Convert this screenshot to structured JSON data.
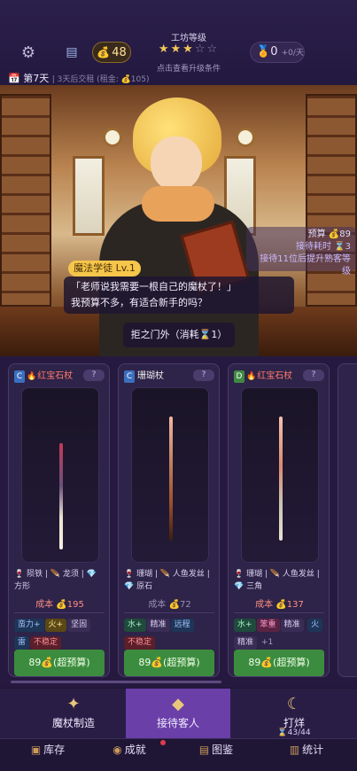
{
  "header": {
    "gold": "48",
    "rank_title": "工坊等级",
    "stars_filled": "★★★",
    "stars_empty": "☆☆",
    "rank_hint": "点击查看升级条件",
    "medal_value": "0",
    "medal_rate": "+0/天",
    "day": "第7天",
    "day_sub": "| 3天后交租 (租金: 💰105)"
  },
  "scene": {
    "budget_line1": "预算 💰89",
    "budget_line2": "接待耗时 ⌛3",
    "budget_line3": "接待11位后提升熟客等级",
    "customer_name": "魔法学徒 Lv.1",
    "dialog_line1": "「老师说我需要一根自己的魔杖了！」",
    "dialog_line2": "我预算不多，有适合新手的吗？",
    "reject_button": "拒之门外（消耗⌛1）"
  },
  "cards": [
    {
      "grade": "C",
      "fire": "🔥",
      "name": "红宝石杖",
      "q": "?",
      "mats": "🍷 陨铁 | 🪶 龙须 | 💎 方形",
      "cost_label": "成本",
      "cost": "💰195",
      "tags": [
        "蛮力+",
        "火+",
        "坚固",
        "雷",
        "不稳定"
      ],
      "buy": "89💰(超预算)"
    },
    {
      "grade": "C",
      "fire": "",
      "name": "珊瑚杖",
      "q": "?",
      "mats": "🍷 珊瑚 | 🪶 人鱼发丝 | 💎 原石",
      "cost_label": "成本",
      "cost": "💰72",
      "tags": [
        "水+",
        "精准",
        "远程",
        "不稳定"
      ],
      "buy": "89💰(超预算)"
    },
    {
      "grade": "D",
      "fire": "🔥",
      "name": "红宝石杖",
      "q": "?",
      "mats": "🍷 珊瑚 | 🪶 人鱼发丝 | 💎 三角",
      "cost_label": "成本",
      "cost": "💰137",
      "tags": [
        "水+",
        "笨重",
        "精准",
        "火",
        "精准",
        "+1"
      ],
      "buy": "89💰(超预算)"
    }
  ],
  "tabs": [
    {
      "label": "魔杖制造",
      "icon": "wand-icon"
    },
    {
      "label": "接待客人",
      "icon": "tag-icon"
    },
    {
      "label": "打烊",
      "icon": "moon-icon",
      "sub": "43/44"
    }
  ],
  "nav": [
    {
      "label": "库存",
      "icon": "box-icon"
    },
    {
      "label": "成就",
      "icon": "medal-icon"
    },
    {
      "label": "图鉴",
      "icon": "book-icon"
    },
    {
      "label": "统计",
      "icon": "chart-icon"
    }
  ],
  "colors": {
    "accent": "#6a3fa8",
    "gold": "#f5c64a",
    "buy": "#3c8c3f"
  }
}
